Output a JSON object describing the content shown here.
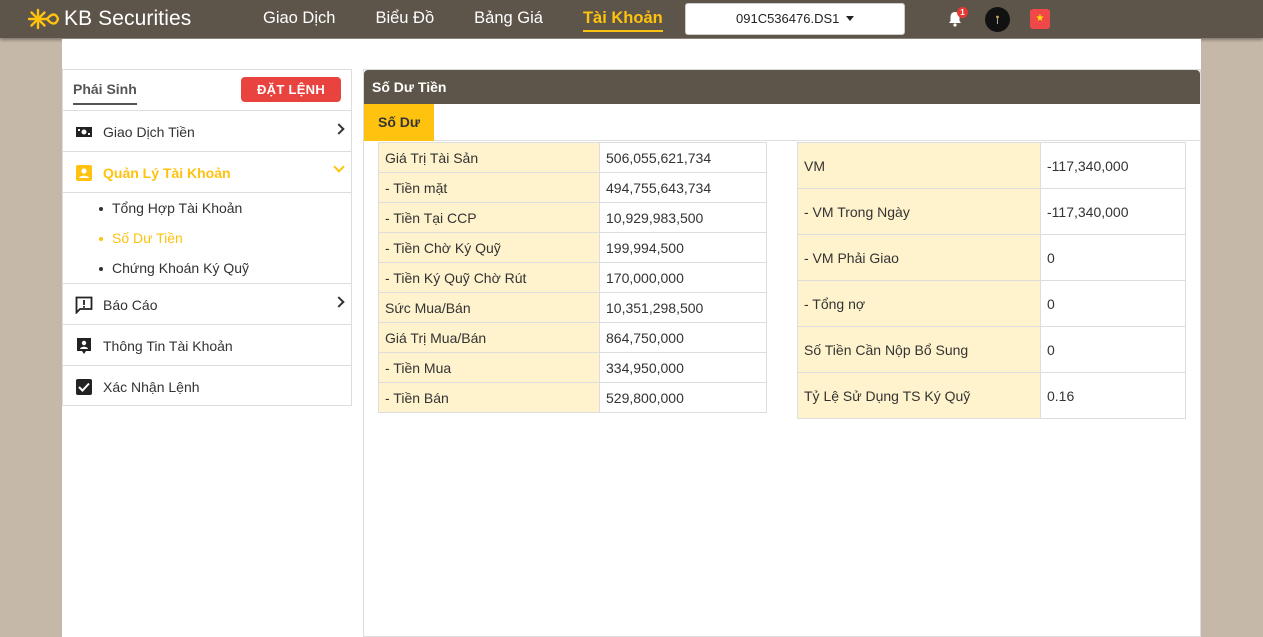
{
  "brand": {
    "name": "KB Securities"
  },
  "nav": [
    {
      "label": "Giao Dịch",
      "active": false
    },
    {
      "label": "Biểu Đồ",
      "active": false
    },
    {
      "label": "Bảng Giá",
      "active": false
    },
    {
      "label": "Tài Khoản",
      "active": true
    }
  ],
  "account": {
    "selected": "091C536476.DS1"
  },
  "notifications": {
    "count": "1"
  },
  "sidebar": {
    "tab": "Phái Sinh",
    "order_button": "ĐẶT LỆNH",
    "items": [
      {
        "label": "Giao Dịch Tiền",
        "icon": "cash-icon"
      },
      {
        "label": "Quản Lý Tài Khoản",
        "icon": "account-box-icon"
      },
      {
        "label": "Báo Cáo",
        "icon": "report-icon"
      },
      {
        "label": "Thông Tin Tài Khoản",
        "icon": "account-info-icon"
      },
      {
        "label": "Xác Nhận Lệnh",
        "icon": "checkbox-icon"
      }
    ],
    "submenu": [
      {
        "label": "Tổng Hợp Tài Khoản"
      },
      {
        "label": "Số Dư Tiền"
      },
      {
        "label": "Chứng Khoán Ký Quỹ"
      }
    ]
  },
  "panel": {
    "title": "Số Dư Tiền",
    "tab": "Số Dư",
    "left_rows": [
      {
        "label": "Giá Trị Tài Sản",
        "value": "506,055,621,734"
      },
      {
        "label": "- Tiền mặt",
        "value": "494,755,643,734"
      },
      {
        "label": "- Tiền Tại CCP",
        "value": "10,929,983,500"
      },
      {
        "label": "- Tiền Chờ Ký Quỹ",
        "value": "199,994,500"
      },
      {
        "label": "- Tiền Ký Quỹ Chờ Rút",
        "value": "170,000,000"
      },
      {
        "label": "Sức Mua/Bán",
        "value": "10,351,298,500"
      },
      {
        "label": "Giá Trị Mua/Bán",
        "value": "864,750,000"
      },
      {
        "label": "- Tiền Mua",
        "value": "334,950,000"
      },
      {
        "label": "- Tiền Bán",
        "value": "529,800,000"
      }
    ],
    "right_rows": [
      {
        "label": "VM",
        "value": "-117,340,000"
      },
      {
        "label": "- VM Trong Ngày",
        "value": "-117,340,000"
      },
      {
        "label": "- VM Phải Giao",
        "value": "0"
      },
      {
        "label": "- Tổng nợ",
        "value": "0"
      },
      {
        "label": "Số Tiền Cần Nộp Bổ Sung",
        "value": "0"
      },
      {
        "label": "Tỷ Lệ Sử Dụng TS Ký Quỹ",
        "value": "0.16"
      }
    ]
  },
  "colors": {
    "header": "#5e554a",
    "accent": "#ffc20e",
    "danger": "#e8433e",
    "key_cell": "#fff3cd"
  }
}
